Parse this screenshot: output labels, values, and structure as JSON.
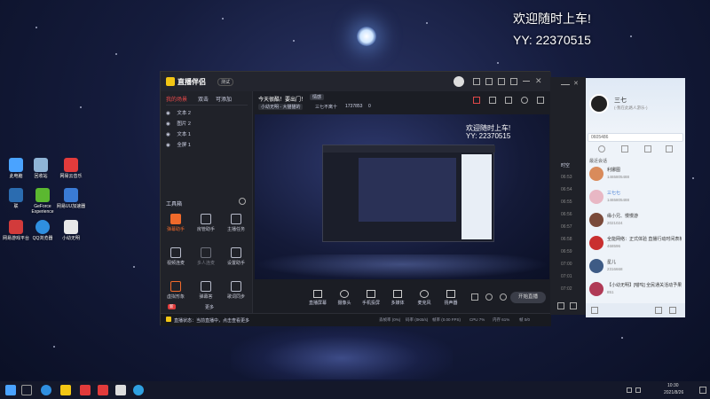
{
  "overlay": {
    "line1": "欢迎随时上车!",
    "line2": "YY:  22370515"
  },
  "desktop_icons": [
    {
      "label": "此电脑",
      "color": "#4aa3ff"
    },
    {
      "label": "回收站",
      "color": "#8fb4d6"
    },
    {
      "label": "网易云音乐",
      "color": "#e23b3b"
    },
    {
      "label": "联",
      "color": "#2b6cb0"
    },
    {
      "label": "GeForce Experience",
      "color": "#5bb830"
    },
    {
      "label": "网易UU加速器",
      "color": "#3a7bd5"
    },
    {
      "label": "网易游戏平台",
      "color": "#d23b3b"
    },
    {
      "label": "QQ浏览器",
      "color": "#2f8fe0"
    },
    {
      "label": "小幼无明",
      "color": "#e8e8e8"
    }
  ],
  "window": {
    "app_name": "直播伴侣",
    "badge": "测试",
    "tabs": [
      "我的场景",
      "双击",
      "可添加"
    ],
    "sources": [
      "文本 2",
      "图片 2",
      "文本 1",
      "全屏 1"
    ],
    "tools_title": "工具箱",
    "tools": [
      "弹幕助手",
      "房管助手",
      "主播任务",
      "视频连麦",
      "多人连麦",
      "设置助手",
      "虚拟形象",
      "弹幕答",
      "歌词同步"
    ],
    "tool_extra": [
      "新",
      "更多"
    ],
    "top_title": "今天很酷！要出门！",
    "top_tag": "情感",
    "sub_info": "小幼无明 - 大猫猫的",
    "sub_user": "三七不离十",
    "sub_id": "1737853",
    "sub_count": "0",
    "bottom_actions": [
      "直播屏幕",
      "摄像头",
      "手机投屏",
      "多媒体",
      "麦克风",
      "扬声器"
    ],
    "start_label": "开始直播",
    "status_notice": "直播状态：当前直播中，点击查看更多",
    "status_items": [
      "丢帧率 (0%)",
      "码率 (0KB/s)",
      "帧率 (0.00 FPS)",
      "CPU 7%",
      "内存 61%",
      "帧 0/0"
    ]
  },
  "chat_win": {
    "header": "时空",
    "times": [
      "06:53",
      "06:54",
      "06:55",
      "06:56",
      "06:57",
      "06:58",
      "06:59",
      "07:00",
      "07:01",
      "07:02"
    ]
  },
  "qq": {
    "nick": "三七",
    "signature": "(-我在此路人游乐-)",
    "search": "0605486",
    "section": "最近会话",
    "contacts": [
      {
        "name": "利娜图",
        "sub": "1465805488",
        "color": "#d98b5b"
      },
      {
        "name": "三七七",
        "sub": "1465805488",
        "color": "#e8b7c4"
      },
      {
        "name": "缘小兄、慢慢游",
        "sub": "2021024",
        "color": "#7a4a3a"
      },
      {
        "name": "全能网络：正式体验 直播行动时间表格中",
        "sub": "468596",
        "color": "#c92f2f"
      },
      {
        "name": "星儿",
        "sub": "2316668",
        "color": "#3e5b85"
      },
      {
        "name": "【小幼无明】[喵呜] 全民通关活动予果!",
        "sub": "851",
        "color": "#b03a56"
      }
    ]
  },
  "taskbar": {
    "time": "10:30",
    "date": "2021/8/26"
  }
}
